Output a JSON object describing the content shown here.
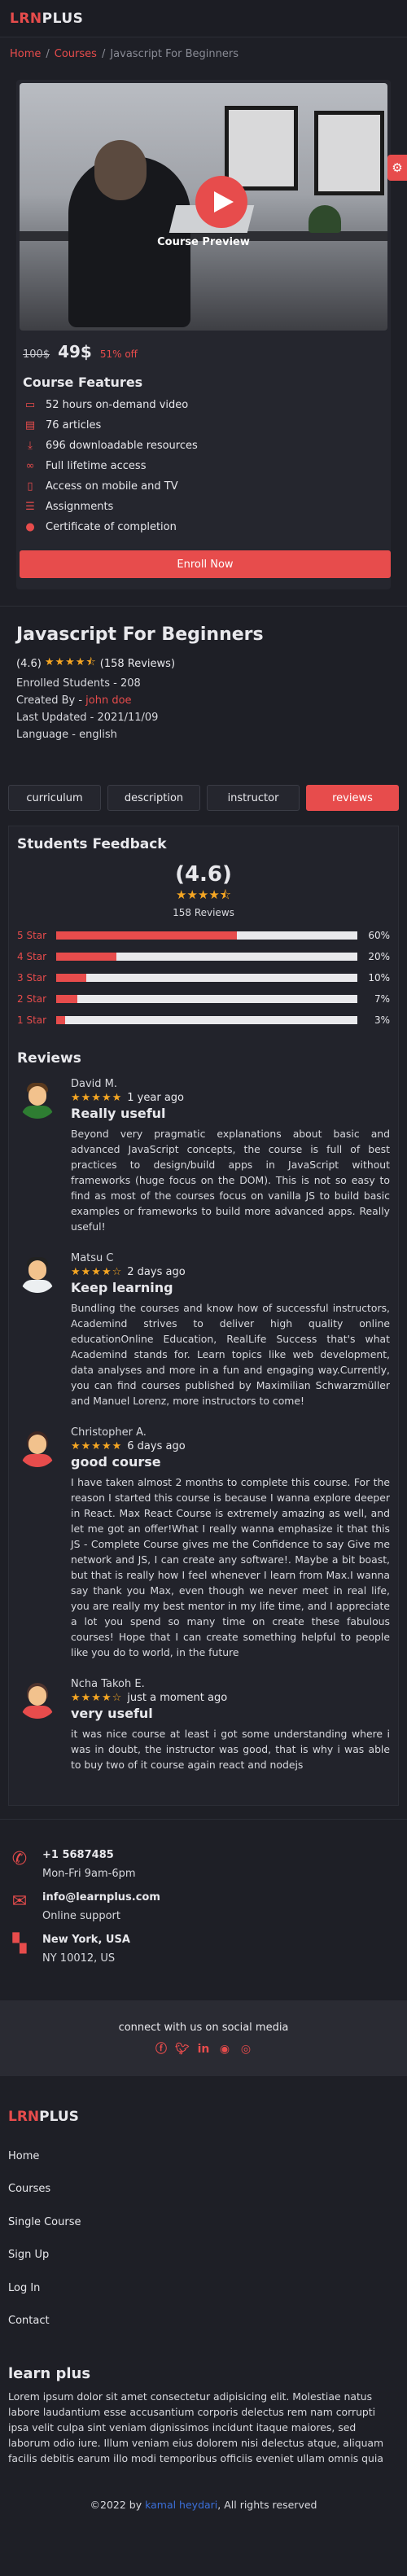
{
  "brand": {
    "logo_accent": "LRN",
    "logo_rest": "PLUS"
  },
  "breadcrumb": {
    "home": "Home",
    "courses": "Courses",
    "current": "Javascript For Beginners",
    "sep": "/"
  },
  "preview": {
    "label": "Course Preview"
  },
  "pricing": {
    "old": "100$",
    "new": "49$",
    "discount": "51% off"
  },
  "features": {
    "title": "Course Features",
    "items": [
      {
        "icon": "monitor-icon",
        "label": "52 hours on-demand video"
      },
      {
        "icon": "file-icon",
        "label": "76 articles"
      },
      {
        "icon": "download-icon",
        "label": "696 downloadable resources"
      },
      {
        "icon": "infinity-icon",
        "label": "Full lifetime access"
      },
      {
        "icon": "tv-icon",
        "label": "Access on mobile and TV"
      },
      {
        "icon": "list-icon",
        "label": "Assignments"
      },
      {
        "icon": "certificate-icon",
        "label": "Certificate of completion"
      }
    ]
  },
  "enroll_label": "Enroll Now",
  "course": {
    "title": "Javascript For Beginners",
    "rating_value": "(4.6)",
    "rating_stars": 4.5,
    "reviews_count": "(158 Reviews)",
    "enrolled": "Enrolled Students - 208",
    "created_by_prefix": "Created By - ",
    "author": "john doe",
    "updated": "Last Updated - 2021/11/09",
    "language": "Language - english"
  },
  "tabs": [
    {
      "label": "curriculum",
      "active": false
    },
    {
      "label": "description",
      "active": false
    },
    {
      "label": "instructor",
      "active": false
    },
    {
      "label": "reviews",
      "active": true
    }
  ],
  "feedback": {
    "title": "Students Feedback",
    "average": "(4.6)",
    "average_stars": 4.5,
    "count_label": "158 Reviews",
    "bars": [
      {
        "label": "5 Star",
        "pct": 60,
        "pct_label": "60%"
      },
      {
        "label": "4 Star",
        "pct": 20,
        "pct_label": "20%"
      },
      {
        "label": "3 Star",
        "pct": 10,
        "pct_label": "10%"
      },
      {
        "label": "2 Star",
        "pct": 7,
        "pct_label": "7%"
      },
      {
        "label": "1 Star",
        "pct": 3,
        "pct_label": "3%"
      }
    ]
  },
  "reviews": {
    "title": "Reviews",
    "items": [
      {
        "name": "David M.",
        "stars": 5,
        "time": "1 year ago",
        "title": "Really useful",
        "avatar_color": "#4caf50",
        "text": "Beyond very pragmatic explanations about basic and advanced JavaScript concepts, the course is full of best practices to design/build apps in JavaScript without frameworks (huge focus on the DOM). This is not so easy to find as most of the courses focus on vanilla JS to build basic examples or frameworks to build more advanced apps. Really useful!"
      },
      {
        "name": "Matsu C",
        "stars": 4,
        "time": "2 days ago",
        "title": "Keep learning",
        "avatar_color": "#26a69a",
        "text": "Bundling the courses and know how of successful instructors, Academind strives to deliver high quality online educationOnline Education, RealLife Success that's what Academind stands for. Learn topics like web development, data analyses and more in a fun and engaging way.Currently, you can find courses published by Maximilian Schwarzmüller and Manuel Lorenz, more instructors to come!"
      },
      {
        "name": "Christopher A.",
        "stars": 5,
        "time": "6 days ago",
        "title": "good course",
        "avatar_color": "#26a69a",
        "text": "I have taken almost 2 months to complete this course. For the reason I started this course is because I wanna explore deeper in React. Max React Course is extremely amazing as well, and let me got an offer!What I really wanna emphasize it that this JS - Complete Course gives me the Confidence to say Give me network and JS, I can create any software!. Maybe a bit boast, but that is really how I feel whenever I learn from Max.I wanna say thank you Max, even though we never meet in real life, you are really my best mentor in my life time, and I appreciate a lot you spend so many time on create these fabulous courses! Hope that I can create something helpful to people like you do to world, in the future"
      },
      {
        "name": "Ncha Takoh E.",
        "stars": 4,
        "time": "just a moment ago",
        "title": "very useful",
        "avatar_color": "#f5a623",
        "text": "it was nice course at least i got some understanding where i was in doubt, the instructor was good, that is why i was able to buy two of it course again react and nodejs"
      }
    ]
  },
  "contact": {
    "phone": "+1 5687485",
    "phone_hours": "Mon-Fri 9am-6pm",
    "email": "info@learnplus.com",
    "email_sub": "Online support",
    "city": "New York, USA",
    "address": "NY 10012, US"
  },
  "social": {
    "title": "connect with us on social media",
    "icons": [
      "facebook-icon",
      "twitter-icon",
      "linkedin-icon",
      "github-icon",
      "instagram-icon"
    ]
  },
  "footer_nav": [
    "Home",
    "Courses",
    "Single Course",
    "Sign Up",
    "Log In",
    "Contact"
  ],
  "about": {
    "title": "learn plus",
    "text": "Lorem ipsum dolor sit amet consectetur adipisicing elit. Molestiae natus labore laudantium esse accusantium corporis delectus rem nam corrupti ipsa velit culpa sint veniam dignissimos incidunt itaque maiores, sed laborum odio iure. Illum veniam eius dolorem nisi delectus atque, aliquam facilis debitis earum illo modi temporibus officiis eveniet ullam omnis quia"
  },
  "copyright": {
    "prefix": "©2022 by ",
    "author": "kamal heydari",
    "suffix": ", All rights reserved"
  },
  "colors": {
    "accent": "#e74c4c",
    "star": "#f5a623",
    "background": "#1e1f26"
  }
}
